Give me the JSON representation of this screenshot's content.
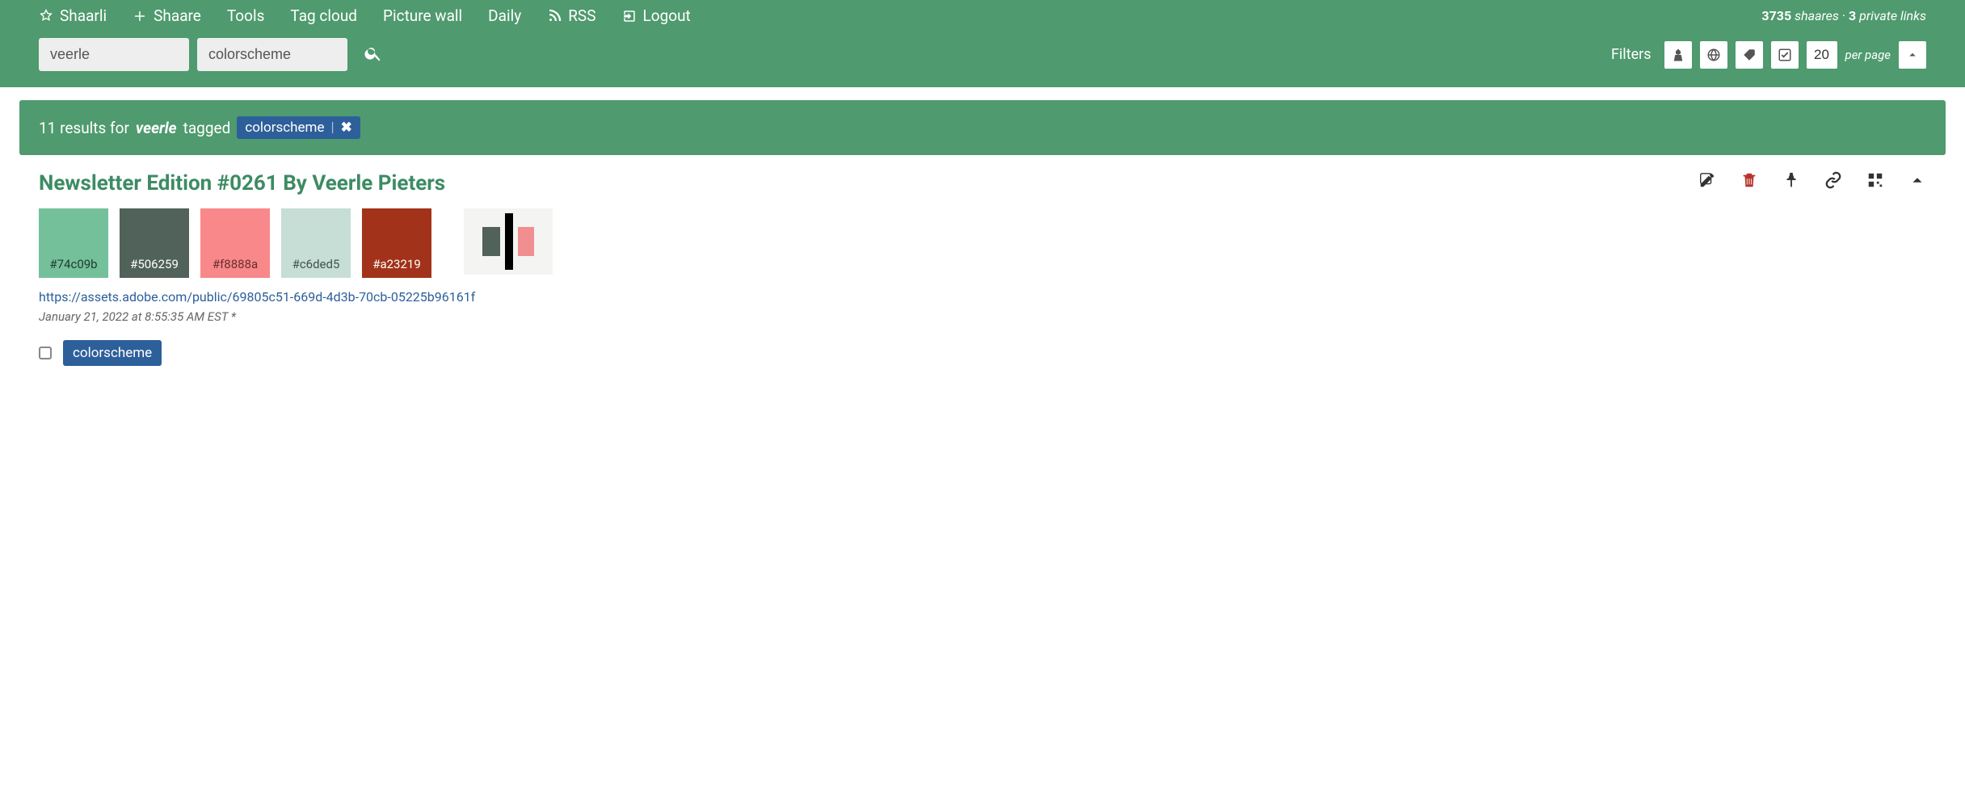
{
  "nav": {
    "brand": "Shaarli",
    "shaare": "Shaare",
    "tools": "Tools",
    "tagcloud": "Tag cloud",
    "picturewall": "Picture wall",
    "daily": "Daily",
    "rss": "RSS",
    "logout": "Logout"
  },
  "stats": {
    "count": "3735",
    "shaares_label": "shaares",
    "sep": "·",
    "private_count": "3",
    "private_label": "private links"
  },
  "search": {
    "text_value": "veerle",
    "tag_value": "colorscheme"
  },
  "filters": {
    "label": "Filters",
    "perpage_value": "20",
    "perpage_label": "per page"
  },
  "results": {
    "prefix": "11 results for",
    "term": "veerle",
    "tagged_label": "tagged",
    "tag": "colorscheme"
  },
  "entry": {
    "title": "Newsletter Edition #0261 By Veerle Pieters",
    "swatches": [
      {
        "hex": "#74c09b",
        "bg": "#74c09b",
        "fg": "#1f3a2e"
      },
      {
        "hex": "#506259",
        "bg": "#506259",
        "fg": "#ffffff"
      },
      {
        "hex": "#f8888a",
        "bg": "#f8888a",
        "fg": "#6a2d2f"
      },
      {
        "hex": "#c6ded5",
        "bg": "#c6ded5",
        "fg": "#3e544c"
      },
      {
        "hex": "#a23219",
        "bg": "#a23219",
        "fg": "#ffffff"
      }
    ],
    "url": "https://assets.adobe.com/public/69805c51-669d-4d3b-70cb-05225b96161f",
    "date": "January 21, 2022 at 8:55:35 AM EST *",
    "tag": "colorscheme"
  }
}
